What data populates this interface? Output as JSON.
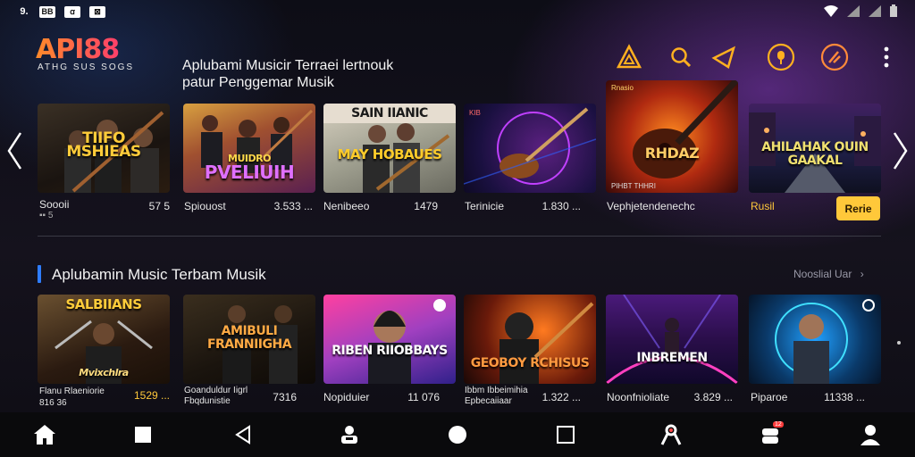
{
  "status_bar": {
    "left_icons": [
      "signal-9-icon",
      "bb-icon",
      "notif-icon",
      "gallery-icon"
    ],
    "left_text": [
      "9.",
      "BB",
      "ꭤ",
      "⊠"
    ],
    "right_icons": [
      "wifi-icon",
      "signal-icon",
      "signal-icon-2",
      "battery-icon"
    ]
  },
  "header": {
    "logo": "API88",
    "logo_sub": "ATHG SUS SOGS",
    "subtitle_line1": "Aplubami Musicir Terraei lertnouk",
    "subtitle_line2": "patur Penggemar Musik",
    "icons": [
      "triangle-logo-icon",
      "search-icon",
      "guitar-icon",
      "mic-icon",
      "edit-icon",
      "more-vertical-icon"
    ]
  },
  "featured": {
    "cards": [
      {
        "title": "TIIFO MSHIEAS",
        "meta_left": "Soooii",
        "meta_left2": "▪▪ 5",
        "meta_right": "57 5"
      },
      {
        "title": "PVELIUIH",
        "title_top": "MUIDRO",
        "meta_left": "Spiouost",
        "meta_right": "3.533 ..."
      },
      {
        "title": "MAY HOBAUES",
        "title_top": "SAIN IIANIC",
        "meta_left": "Nenibeeo",
        "meta_right": "1479"
      },
      {
        "title": "",
        "tag": "KIB",
        "meta_left": "Terinicie",
        "meta_right": "1.830 ..."
      },
      {
        "title": "RHDAZ",
        "tag": "Rnasio",
        "tag_bottom": "PIHBT THHRI",
        "meta_left": "Vephjetendenechc",
        "meta_right": ""
      },
      {
        "title": "AHILAHAK OUIN GAAKAL",
        "meta_left": "Rusil",
        "meta_right": ""
      }
    ],
    "play_button": "Rerie"
  },
  "section": {
    "title": "Aplubamin Music Terbam Musik",
    "link": "Nooslial Uar",
    "cards": [
      {
        "title": "SALBIIANS",
        "title_bottom": "Mvixchlra",
        "meta_left": "Flanu Rlaeniorie",
        "meta_left2": "816 36",
        "meta_right": "1529 ..."
      },
      {
        "title": "AMIBULI FRANNIIGHA",
        "meta_left": "Goanduldur Iigrl",
        "meta_left2": "Fbqdunistie",
        "meta_right": "7316"
      },
      {
        "title": "RIBEN RIIOBBAYS",
        "meta_left": "Nopiduier",
        "meta_right": "11 076"
      },
      {
        "title": "GEOBOY RCHISUS",
        "meta_left": "Ibbm Ibbeimihia",
        "meta_left2": "Epbecaiiaar",
        "meta_right": "1.322 ..."
      },
      {
        "title": "INBREMEN",
        "meta_left": "Noonfnioliate",
        "meta_right": "3.829 ..."
      },
      {
        "title": "",
        "meta_left": "Piparoe",
        "meta_right": "11338 ..."
      }
    ]
  },
  "nav": {
    "items": [
      "home-icon",
      "square-icon",
      "back-icon",
      "profile-switch-icon",
      "circle-home-icon",
      "recents-icon",
      "ribbon-icon",
      "game-icon",
      "person-icon"
    ],
    "badge": "12"
  },
  "colors": {
    "accent": "#ffc83a",
    "brand_gradient": [
      "#ff8a2a",
      "#ff3f6a"
    ],
    "section_bar": "#2e7dff"
  }
}
